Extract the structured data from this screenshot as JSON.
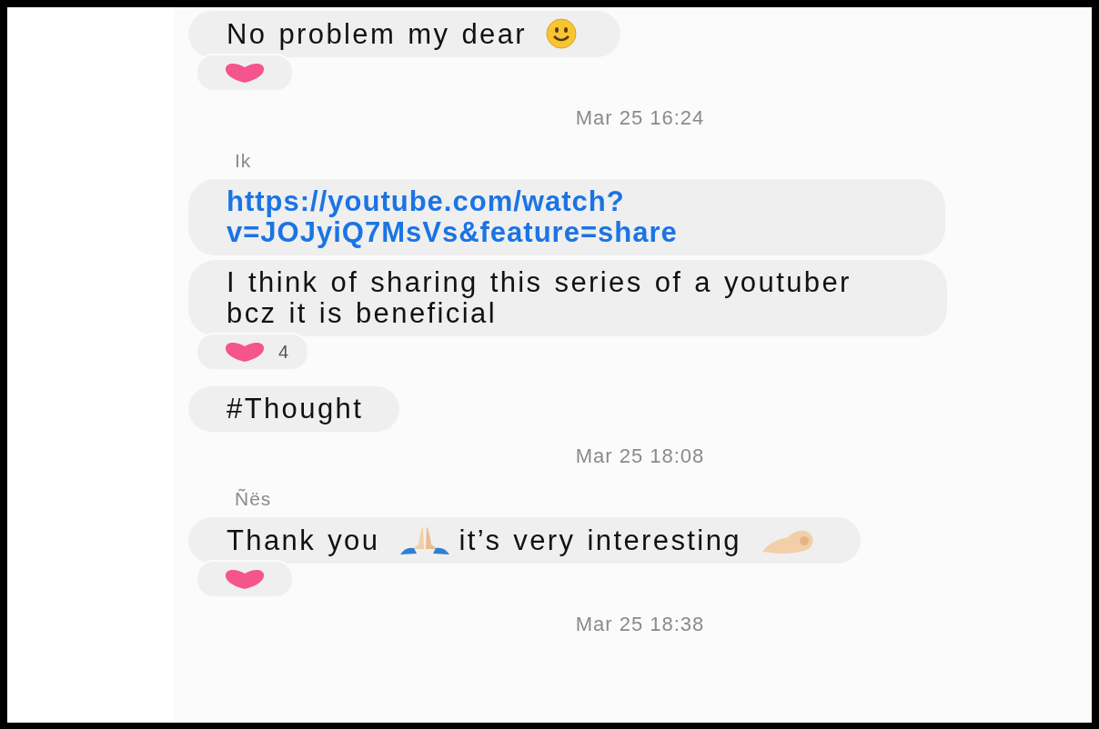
{
  "messages": [
    {
      "kind": "bubble",
      "segments": [
        {
          "kind": "text",
          "text": "No problem my dear"
        },
        {
          "kind": "smile"
        }
      ],
      "reaction": true
    },
    {
      "kind": "timestamp",
      "text": "Mar 25 16:24"
    },
    {
      "kind": "sender",
      "text": "Ik"
    },
    {
      "kind": "bubble",
      "segments": [
        {
          "kind": "link",
          "text": "https://youtube.com/watch?v=JOJyiQ7MsVs&feature=share"
        }
      ],
      "reaction": false
    },
    {
      "kind": "bubble",
      "segments": [
        {
          "kind": "text",
          "text": "I think of sharing this series of a youtuber bcz it is beneficial"
        }
      ],
      "reaction": true,
      "reaction_count": "4"
    },
    {
      "kind": "bubble",
      "segments": [
        {
          "kind": "text",
          "text": "#Thought"
        }
      ],
      "reaction": false
    },
    {
      "kind": "timestamp",
      "text": "Mar 25 18:08"
    },
    {
      "kind": "sender",
      "text": "Ñës"
    },
    {
      "kind": "bubble",
      "segments": [
        {
          "kind": "text",
          "text": "Thank you"
        },
        {
          "kind": "pray"
        },
        {
          "kind": "text",
          "text": "it’s very interesting"
        },
        {
          "kind": "ok_hand"
        }
      ],
      "reaction": true
    },
    {
      "kind": "timestamp",
      "text": "Mar 25 18:38"
    }
  ]
}
